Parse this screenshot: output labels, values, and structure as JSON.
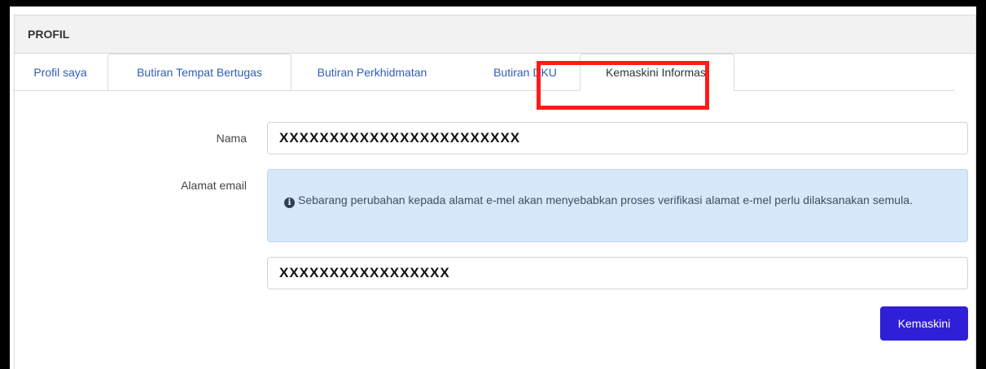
{
  "card": {
    "title": "PROFIL"
  },
  "tabs": [
    {
      "label": "Profil saya"
    },
    {
      "label": "Butiran Tempat Bertugas"
    },
    {
      "label": "Butiran Perkhidmatan"
    },
    {
      "label": "Butiran DKU"
    },
    {
      "label": "Kemaskini Informasi"
    }
  ],
  "form": {
    "name_label": "Nama",
    "name_value": "XXXXXXXXXXXXXXXXXXXXXXXX",
    "email_label": "Alamat email",
    "email_notice": "Sebarang perubahan kepada alamat e-mel akan menyebabkan proses verifikasi alamat e-mel perlu dilaksanakan semula.",
    "email_value": "XXXXXXXXXXXXXXXXX",
    "submit_label": "Kemaskini"
  },
  "icons": {
    "notice": "info-circle-icon"
  },
  "colors": {
    "accent_button": "#2f1fd6",
    "tab_link": "#2f5db8",
    "alert_bg": "#d7e8fb",
    "annotation_border": "#ff1a1a"
  }
}
